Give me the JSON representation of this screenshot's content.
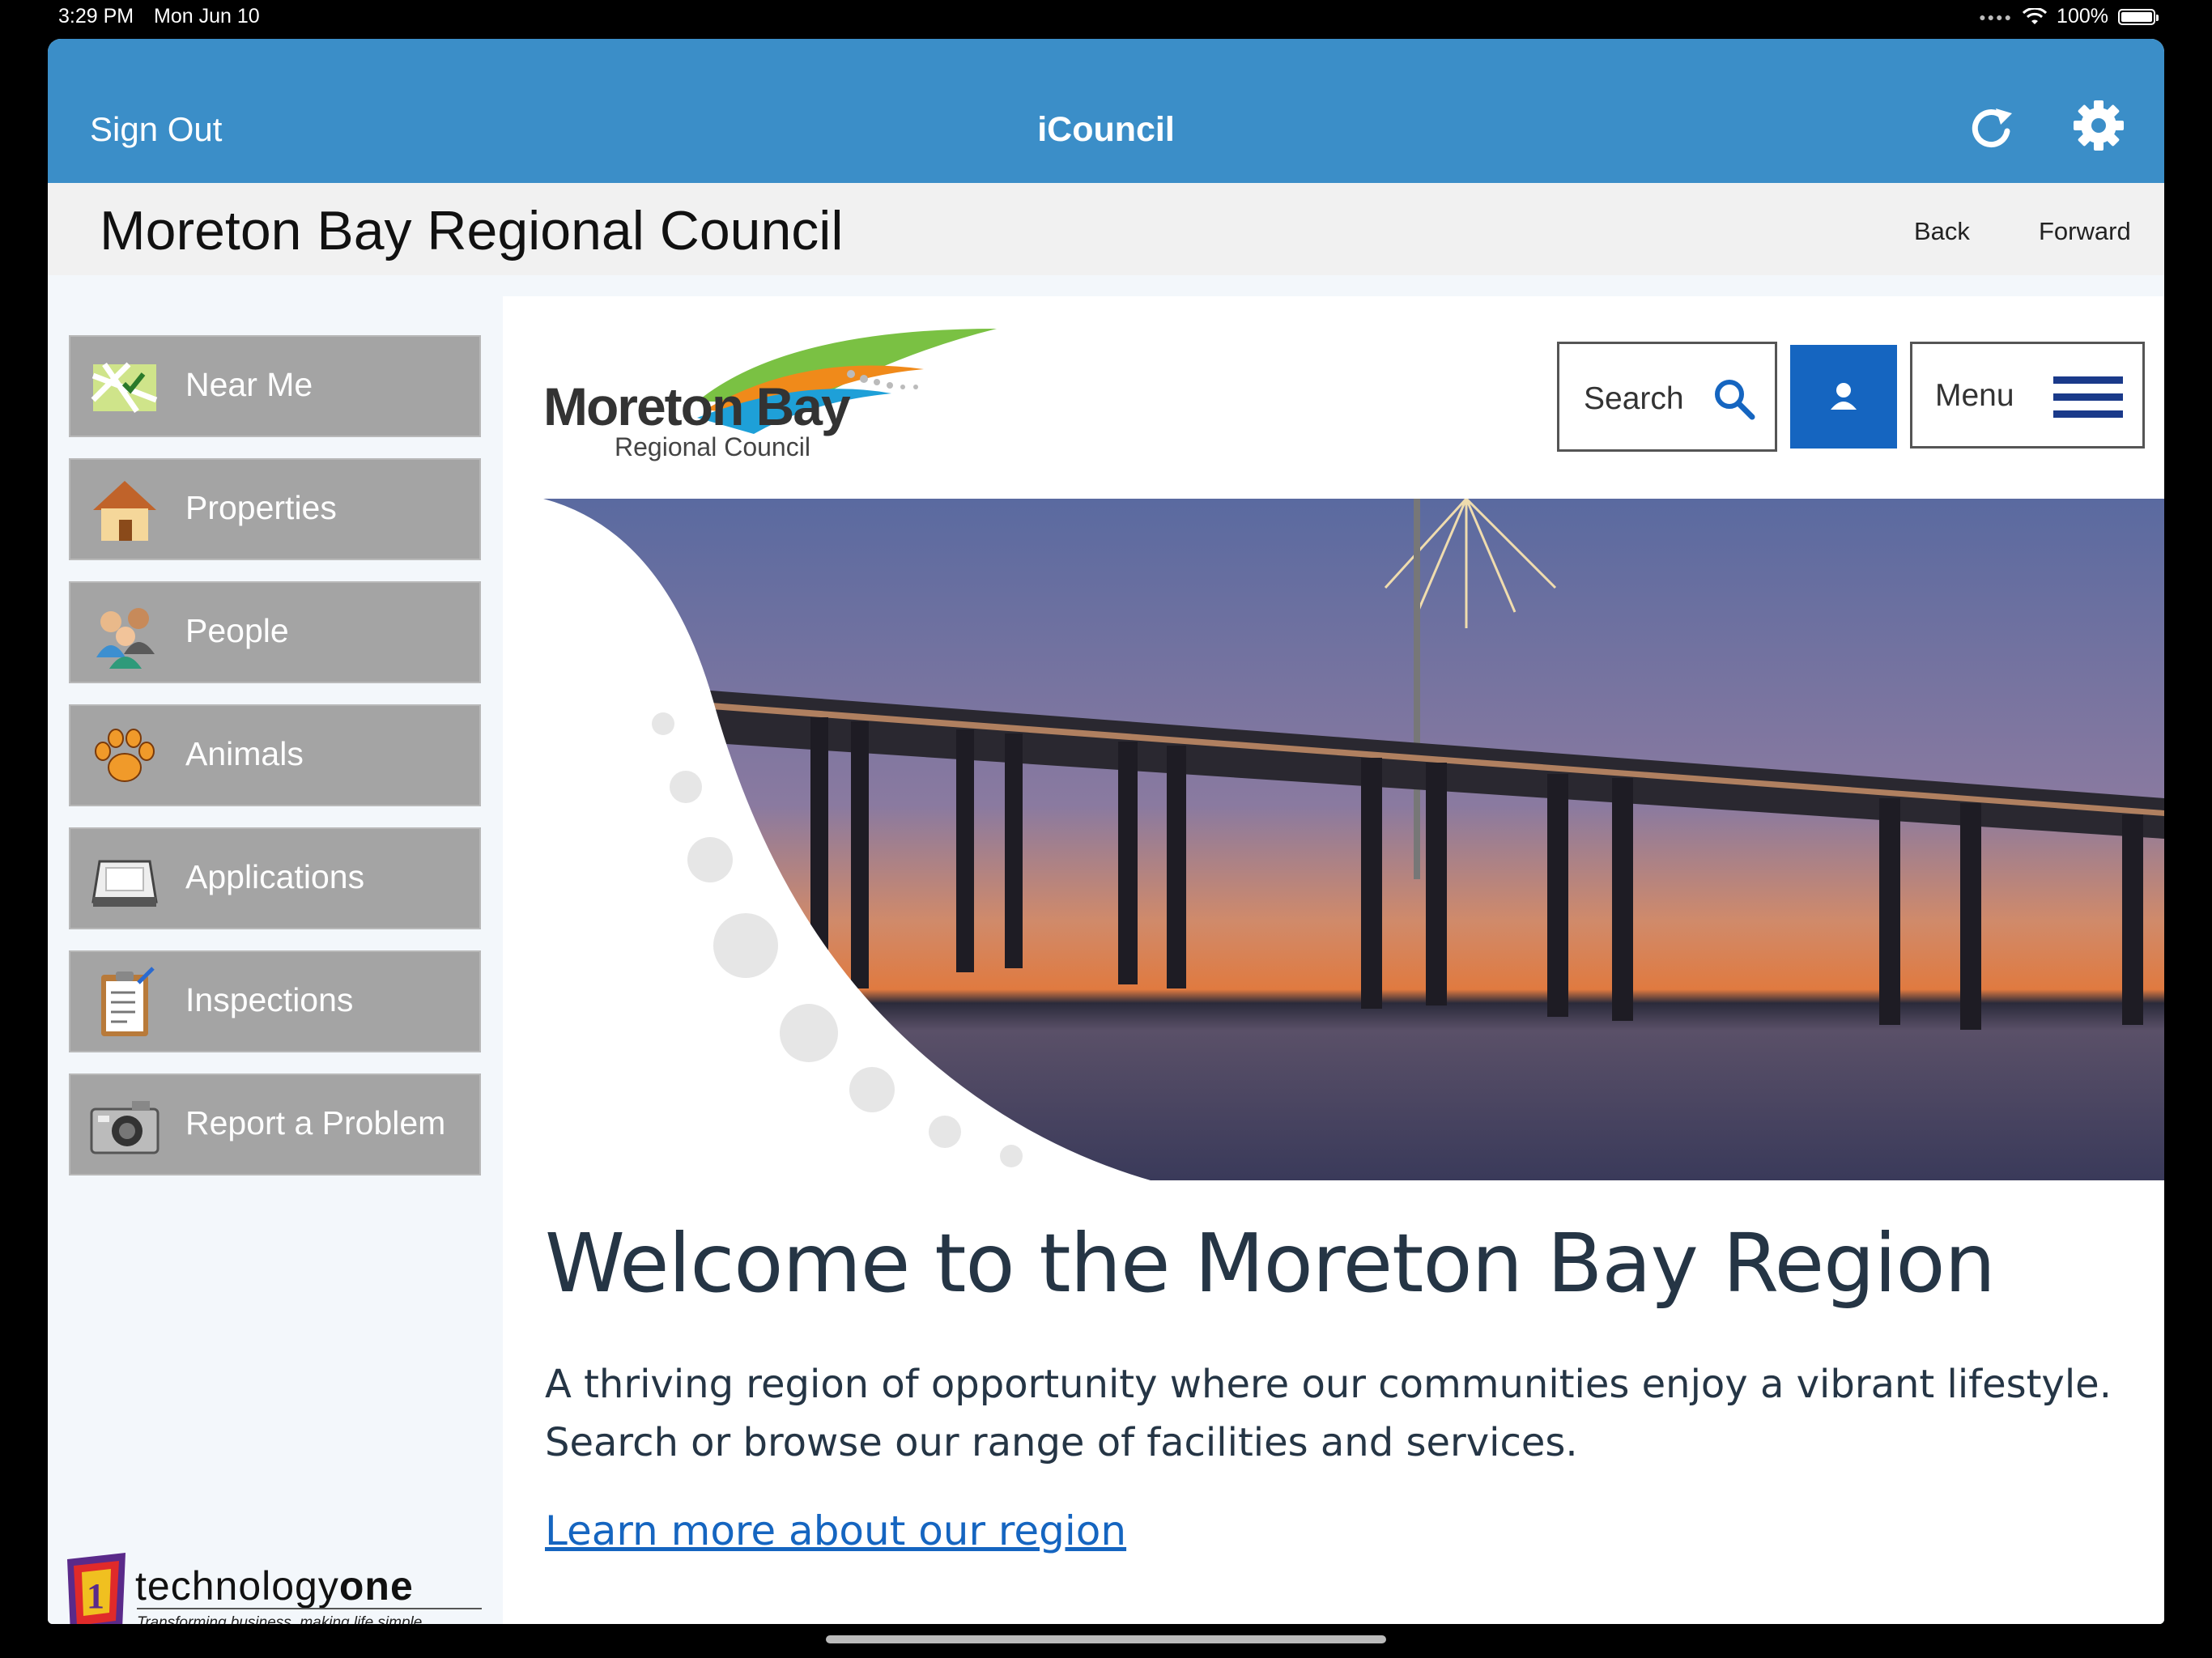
{
  "status_bar": {
    "time": "3:29 PM",
    "date": "Mon Jun 10",
    "battery": "100%"
  },
  "navbar": {
    "sign_out": "Sign Out",
    "title": "iCouncil",
    "icons": [
      "refresh-icon",
      "gear-icon"
    ]
  },
  "council_bar": {
    "name": "Moreton Bay Regional Council",
    "back": "Back",
    "forward": "Forward"
  },
  "sidebar": {
    "items": [
      {
        "label": "Near Me",
        "icon": "map-icon"
      },
      {
        "label": "Properties",
        "icon": "house-icon"
      },
      {
        "label": "People",
        "icon": "people-icon"
      },
      {
        "label": "Animals",
        "icon": "paw-icon"
      },
      {
        "label": "Applications",
        "icon": "tray-icon"
      },
      {
        "label": "Inspections",
        "icon": "clipboard-icon"
      },
      {
        "label": "Report a Problem",
        "icon": "camera-icon"
      }
    ],
    "footer_logo": {
      "brand_light": "technology",
      "brand_bold": "one",
      "tagline": "Transforming business, making life simple"
    }
  },
  "web": {
    "logo": {
      "line1": "Moreton Bay",
      "line2": "Regional Council"
    },
    "search_label": "Search",
    "menu_label": "Menu",
    "welcome_title": "Welcome to the Moreton Bay Region",
    "intro": "A thriving region of opportunity where our communities enjoy a vibrant lifestyle. Search or browse our range of facilities and services.",
    "learn_more": "Learn more about our region"
  },
  "colors": {
    "navbar": "#3b8ec8",
    "sidebar_button": "#a4a4a4",
    "link": "#1565c0",
    "heading": "#253545"
  }
}
